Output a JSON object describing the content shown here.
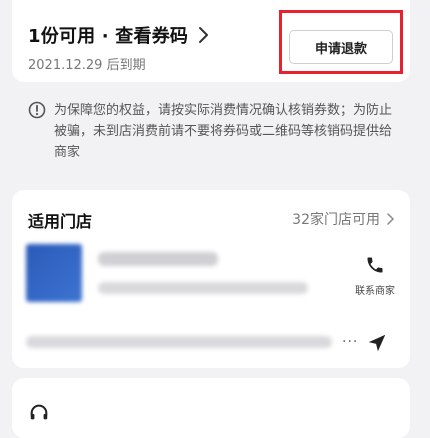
{
  "voucher": {
    "title": "1份可用 · 查看券码",
    "expire_text": "2021.12.29 后到期",
    "refund_button_label": "申请退款"
  },
  "notice": {
    "text": "为保障您的权益，请按实际消费情况确认核销券数；为防止被骗，未到店消费前请不要将券码或二维码等核销码提供给商家"
  },
  "stores": {
    "title": "适用门店",
    "count_text": "32家门店可用",
    "contact_label": "联系商家",
    "dots": "..."
  },
  "colors": {
    "background": "#f2f2f4",
    "card": "#ffffff",
    "highlight_red": "#e8202f",
    "thumbnail_blue": "#2a5ab8"
  },
  "icons": {
    "title_chevron": "chevron-right-icon",
    "notice": "info-icon",
    "store_count_chevron": "chevron-right-icon",
    "contact": "phone-icon",
    "navigation": "navigation-arrow-icon",
    "support": "headset-icon"
  }
}
